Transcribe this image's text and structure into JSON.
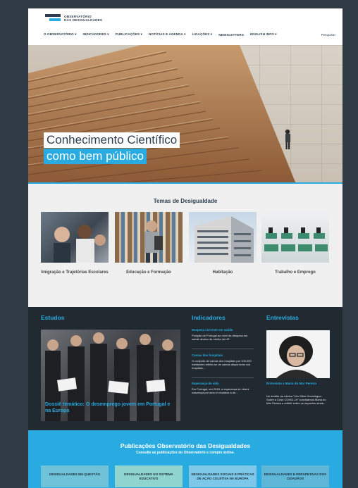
{
  "logo": {
    "line1": "OBSERVATÓRIO",
    "line2": "DAS DESIGUALDADES"
  },
  "nav": {
    "items": [
      "O OBSERVATÓRIO",
      "INDICADORES",
      "PUBLICAÇÕES",
      "NOTÍCIAS E AGENDA",
      "LIGAÇÕES",
      "NEWSLETTERS",
      "ENGLISH INFO"
    ],
    "search": "Pesquisar"
  },
  "hero": {
    "line1": "Conhecimento Científico",
    "line2": "como bem público"
  },
  "temas": {
    "title": "Temas de Desigualdade",
    "items": [
      "Imigração e Trajetórias Escolares",
      "Educação e Formação",
      "Habitação",
      "Trabalho e Emprego"
    ]
  },
  "estudos": {
    "title": "Estudos",
    "caption": "Dossiê temático: O desemprego jovem em Portugal e na Europa"
  },
  "indicadores": {
    "title": "Indicadores",
    "items": [
      {
        "title": "Despesa corrente em saúde",
        "desc": "Posição de Portugal ao nível da despesa em saúde abaixo da média da UE."
      },
      {
        "title": "Camas dos hospitais",
        "desc": "O conjunto de camas dos hospitais por 100.000 habitantes reflete-se de camas disponíveis nos hospitais..."
      },
      {
        "title": "Esperança de vida",
        "desc": "Em Portugal, em 2018, a esperança de vida à nascença por sexo e reunidos à de..."
      }
    ]
  },
  "entrevistas": {
    "title": "Entrevistas",
    "name": "Entrevista a Maria do Mar Pereira",
    "desc": "No âmbito da rubrica \"Um Olhar Sociológico Sobre a Crise COVID-19\" convidámos Maria do Mar Pereira a refletir sobre os impactos desta..."
  },
  "publicacoes": {
    "title": "Publicações Observatório das Desigualdades",
    "subtitle": "Consulte as publicações do Observatório e compre online.",
    "cards": [
      "DESIGUALDADES EM QUESTÃO",
      "DESIGUALDADES NO SISTEMA EDUCATIVO",
      "DESIGUALDADES SOCIAIS E PRÁTICAS DE AÇÃO COLETIVA NA EUROPA",
      "DESIGUALDADES E PERSPETIVAS DOS CIDADÃOS"
    ]
  },
  "colors": {
    "accent": "#29abe2",
    "dark": "#222a31",
    "navy": "#2e3e4e"
  }
}
